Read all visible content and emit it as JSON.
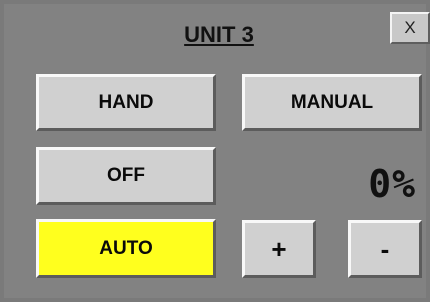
{
  "window": {
    "title": "UNIT 3",
    "close_label": "X"
  },
  "mode_buttons": {
    "hand": "HAND",
    "manual": "MANUAL",
    "off": "OFF",
    "auto": "AUTO",
    "active": "AUTO"
  },
  "output": {
    "display": "0%",
    "percent": 0
  },
  "adjust_buttons": {
    "increase": "+",
    "decrease": "-"
  },
  "colors": {
    "panel_background": "#828282",
    "button_face": "#d0d0d0",
    "active_button": "#ffff1e"
  }
}
